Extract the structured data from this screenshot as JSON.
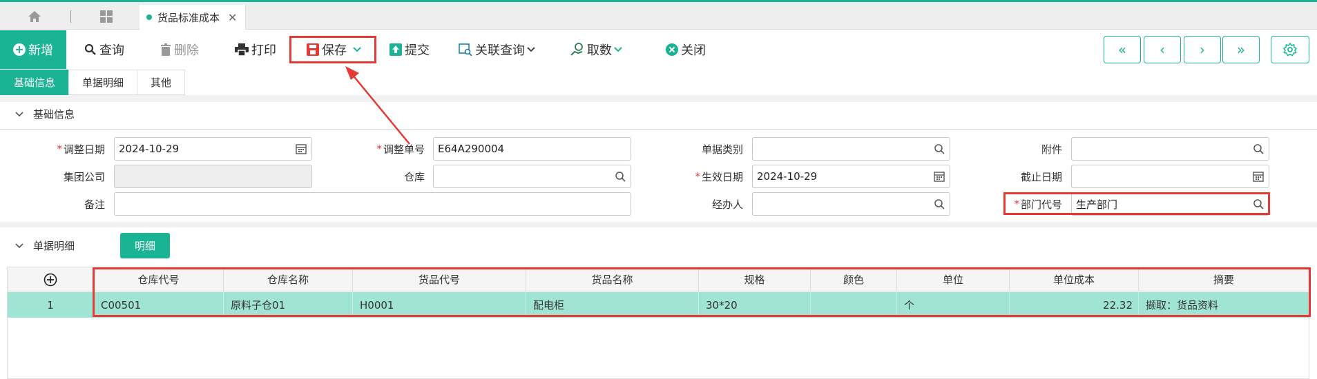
{
  "tabs": {
    "document_tab": "货品标准成本"
  },
  "toolbar": {
    "new": "新增",
    "query": "查询",
    "delete": "删除",
    "print": "打印",
    "save": "保存",
    "submit": "提交",
    "related_query": "关联查询",
    "fetch": "取数",
    "close": "关闭"
  },
  "subtabs": [
    "基础信息",
    "单据明细",
    "其他"
  ],
  "basic": {
    "section_title": "基础信息",
    "adjust_date_label": "调整日期",
    "adjust_date": "2024-10-29",
    "adjust_no_label": "调整单号",
    "adjust_no": "E64A290004",
    "doc_type_label": "单据类别",
    "doc_type": "",
    "attachment_label": "附件",
    "attachment": "",
    "group_company_label": "集团公司",
    "group_company": "",
    "warehouse_label": "仓库",
    "warehouse": "",
    "effective_date_label": "生效日期",
    "effective_date": "2024-10-29",
    "end_date_label": "截止日期",
    "end_date": "",
    "remark_label": "备注",
    "remark": "",
    "handler_label": "经办人",
    "handler": "",
    "dept_label": "部门代号",
    "dept": "生产部门"
  },
  "detail": {
    "section_title": "单据明细",
    "detail_button": "明细",
    "add_icon": "plus-circle-icon",
    "columns": [
      "仓库代号",
      "仓库名称",
      "货品代号",
      "货品名称",
      "规格",
      "颜色",
      "单位",
      "单位成本",
      "摘要"
    ],
    "rows": [
      {
        "no": "1",
        "wh_code": "C00501",
        "wh_name": "原料子仓01",
        "item_code": "H0001",
        "item_name": "配电柜",
        "spec": "30*20",
        "color": "",
        "unit": "个",
        "unit_cost": "22.32",
        "summary": "撷取：货品资料"
      }
    ]
  },
  "colors": {
    "accent": "#1ab394",
    "highlight_row": "#a0e4d3",
    "annotation": "#e53935"
  }
}
